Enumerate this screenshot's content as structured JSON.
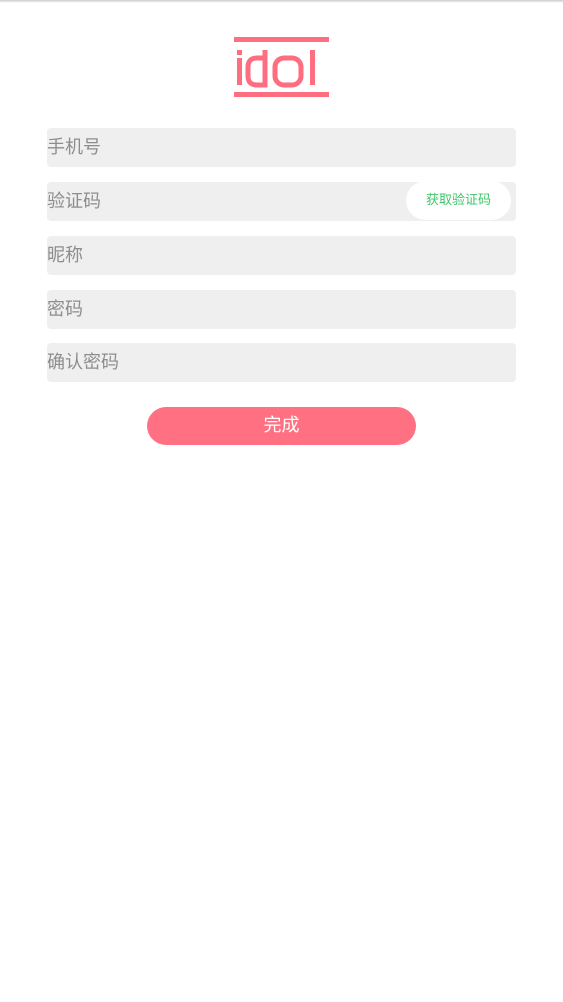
{
  "logo": {
    "text": "idol",
    "color": "#ff6e80"
  },
  "form": {
    "phone_placeholder": "手机号",
    "code_placeholder": "验证码",
    "get_code_label": "获取验证码",
    "nickname_placeholder": "昵称",
    "password_placeholder": "密码",
    "confirm_password_placeholder": "确认密码"
  },
  "actions": {
    "done_label": "完成"
  },
  "colors": {
    "accent": "#ff7182",
    "field_bg": "#efefef",
    "get_code_text": "#3fc46b"
  }
}
